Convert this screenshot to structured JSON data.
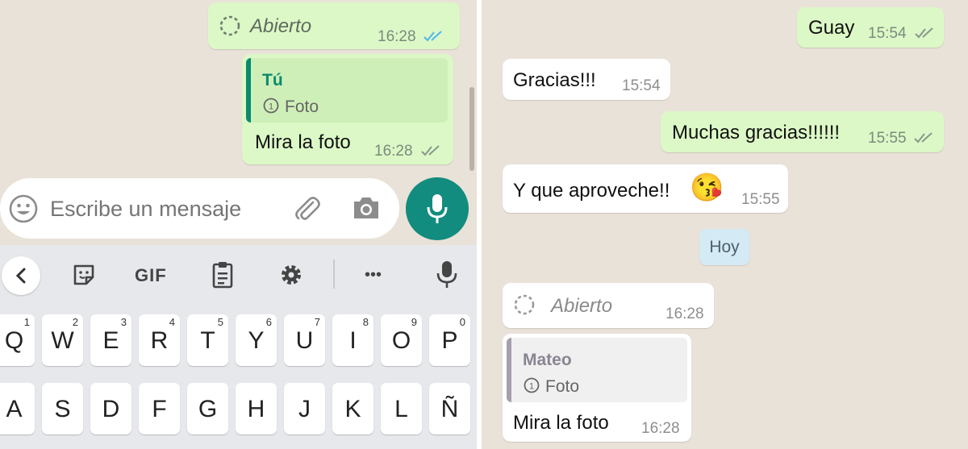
{
  "left": {
    "msg_opened": {
      "text": "Abierto",
      "time": "16:28"
    },
    "msg_photo": {
      "quote_author": "Tú",
      "quote_label": "Foto",
      "text": "Mira la foto",
      "time": "16:28"
    },
    "input": {
      "placeholder": "Escribe un mensaje"
    },
    "keyboard": {
      "toolbar": {
        "gif": "GIF",
        "more": "•••"
      },
      "row1": [
        {
          "k": "Q",
          "n": "1"
        },
        {
          "k": "W",
          "n": "2"
        },
        {
          "k": "E",
          "n": "3"
        },
        {
          "k": "R",
          "n": "4"
        },
        {
          "k": "T",
          "n": "5"
        },
        {
          "k": "Y",
          "n": "6"
        },
        {
          "k": "U",
          "n": "7"
        },
        {
          "k": "I",
          "n": "8"
        },
        {
          "k": "O",
          "n": "9"
        },
        {
          "k": "P",
          "n": "0"
        }
      ],
      "row2": [
        "A",
        "S",
        "D",
        "F",
        "G",
        "H",
        "J",
        "K",
        "L",
        "Ñ"
      ]
    }
  },
  "right": {
    "msg_guay": {
      "text": "Guay",
      "time": "15:54"
    },
    "msg_gracias": {
      "text": "Gracias!!!",
      "time": "15:54"
    },
    "msg_muchas": {
      "text": "Muchas gracias!!!!!!",
      "time": "15:55"
    },
    "msg_aproveche": {
      "text": "Y que aproveche!!",
      "emoji": "😘",
      "time": "15:55"
    },
    "date_chip": "Hoy",
    "msg_opened": {
      "text": "Abierto",
      "time": "16:28"
    },
    "msg_photo": {
      "quote_author": "Mateo",
      "quote_label": "Foto",
      "text": "Mira la foto",
      "time": "16:28"
    }
  },
  "colors": {
    "outgoing": "#dcf8c6",
    "incoming": "#ffffff",
    "wallpaper": "#e9e2d8",
    "teal": "#128c7e",
    "tick_read": "#4fb6ec",
    "tick_sent": "#8a978a",
    "quote_self": "#0a8a6e",
    "quote_other": "#a59fad"
  },
  "icons": [
    "view-once-icon",
    "double-check-icon",
    "emoji-icon",
    "attach-icon",
    "camera-icon",
    "mic-icon",
    "back-chevron-icon",
    "sticker-icon",
    "clipboard-icon",
    "settings-icon",
    "keyboard-mic-icon"
  ]
}
